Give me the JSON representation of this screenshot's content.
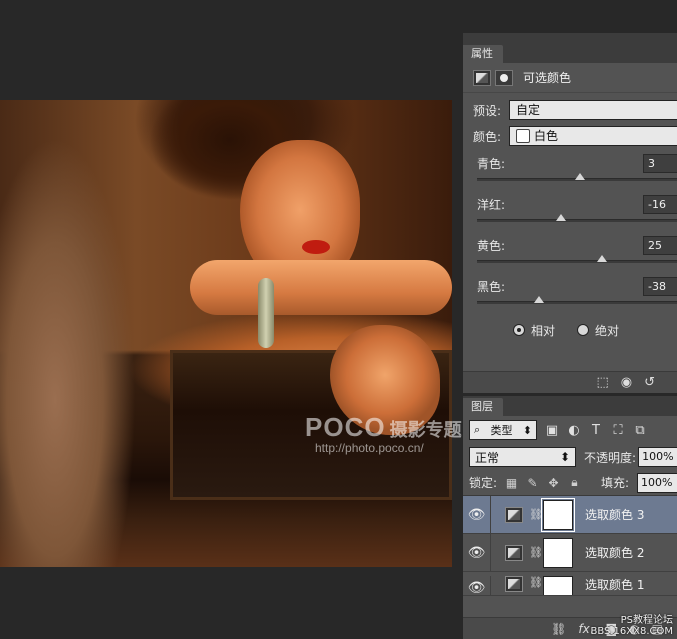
{
  "canvas": {
    "watermark_brand": "POCO",
    "watermark_title": "摄影专题",
    "watermark_url": "http://photo.poco.cn/"
  },
  "properties": {
    "tab_label": "属性",
    "title": "可选颜色",
    "preset_label": "预设:",
    "preset_value": "自定",
    "colors_label": "颜色:",
    "colors_value": "白色",
    "sliders": [
      {
        "label": "青色:",
        "value": "3",
        "level": 3
      },
      {
        "label": "洋红:",
        "value": "-16",
        "level": -16
      },
      {
        "label": "黄色:",
        "value": "25",
        "level": 25
      },
      {
        "label": "黑色:",
        "value": "-38",
        "level": -38
      }
    ],
    "radio_relative": "相对",
    "radio_absolute": "绝对",
    "method_selected": "相对"
  },
  "layers": {
    "tab_label": "图层",
    "kind_label": "类型",
    "blend_mode": "正常",
    "opacity_label": "不透明度:",
    "opacity_value": "100%",
    "lock_label": "锁定:",
    "fill_label": "填充:",
    "fill_value": "100%",
    "items": [
      {
        "name": "选取颜色 3",
        "selected": true
      },
      {
        "name": "选取颜色 2",
        "selected": false
      },
      {
        "name": "选取颜色 1",
        "selected": false
      }
    ]
  },
  "credit": {
    "line1": "PS教程论坛",
    "line2": "BBS.16XX8.COM"
  }
}
